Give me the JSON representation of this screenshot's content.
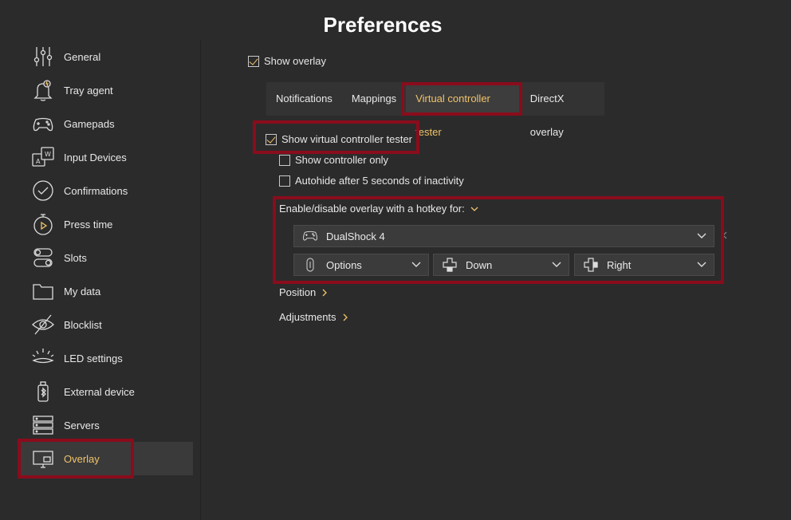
{
  "title": "Preferences",
  "sidebar": {
    "items": [
      {
        "label": "General",
        "icon": "sliders-icon"
      },
      {
        "label": "Tray agent",
        "icon": "bell-icon"
      },
      {
        "label": "Gamepads",
        "icon": "gamepad-icon"
      },
      {
        "label": "Input Devices",
        "icon": "keyboard-keys-icon"
      },
      {
        "label": "Confirmations",
        "icon": "checkmark-circle-icon"
      },
      {
        "label": "Press time",
        "icon": "stopwatch-icon"
      },
      {
        "label": "Slots",
        "icon": "toggles-icon"
      },
      {
        "label": "My data",
        "icon": "folder-icon"
      },
      {
        "label": "Blocklist",
        "icon": "eye-off-icon"
      },
      {
        "label": "LED settings",
        "icon": "led-lamp-icon"
      },
      {
        "label": "External device",
        "icon": "bluetooth-device-icon"
      },
      {
        "label": "Servers",
        "icon": "server-icon"
      },
      {
        "label": "Overlay",
        "icon": "monitor-icon",
        "active": true
      }
    ]
  },
  "show_overlay": {
    "label": "Show overlay",
    "checked": true
  },
  "tabs": [
    {
      "label": "Notifications"
    },
    {
      "label": "Mappings"
    },
    {
      "label": "Virtual controller tester",
      "active": true
    },
    {
      "label": "DirectX overlay"
    }
  ],
  "options": {
    "show_tester": {
      "label": "Show virtual controller tester",
      "checked": true
    },
    "controller_only": {
      "label": "Show controller only",
      "checked": false
    },
    "autohide": {
      "label": "Autohide after 5 seconds of inactivity",
      "checked": false
    }
  },
  "hotkey": {
    "heading": "Enable/disable overlay with a hotkey for:",
    "device": "DualShock 4",
    "button1": "Options",
    "button2": "Down",
    "button3": "Right"
  },
  "sections": {
    "position": "Position",
    "adjustments": "Adjustments"
  },
  "colors": {
    "accent": "#f0c36a",
    "highlight": "#8a0c1c",
    "background": "#2b2b2b"
  }
}
